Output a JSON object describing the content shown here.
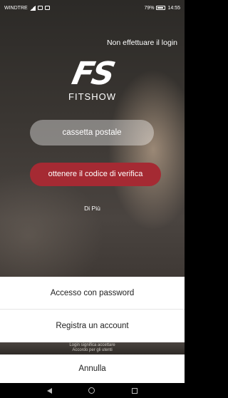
{
  "status_bar": {
    "carrier": "WINDTRE",
    "battery": "79%",
    "time": "14:55"
  },
  "header": {
    "skip_login": "Non effettuare il login"
  },
  "logo": {
    "mark": "FS",
    "name": "FITSHOW"
  },
  "form": {
    "email_placeholder": "cassetta postale",
    "get_code_button": "ottenere il codice di verifica",
    "more_link": "Di Più"
  },
  "sheet": {
    "items": [
      {
        "label": "Accesso con password"
      },
      {
        "label": "Registra un account"
      }
    ],
    "peek_text_line1": "Login significa accettare",
    "peek_text_line2": "Accordo per gli utenti",
    "cancel": "Annulla"
  },
  "icons": {
    "back": "back-triangle-icon",
    "home": "home-circle-icon",
    "recent": "recent-square-icon"
  },
  "colors": {
    "accent": "#a52a33",
    "sheet_bg": "#ffffff"
  }
}
